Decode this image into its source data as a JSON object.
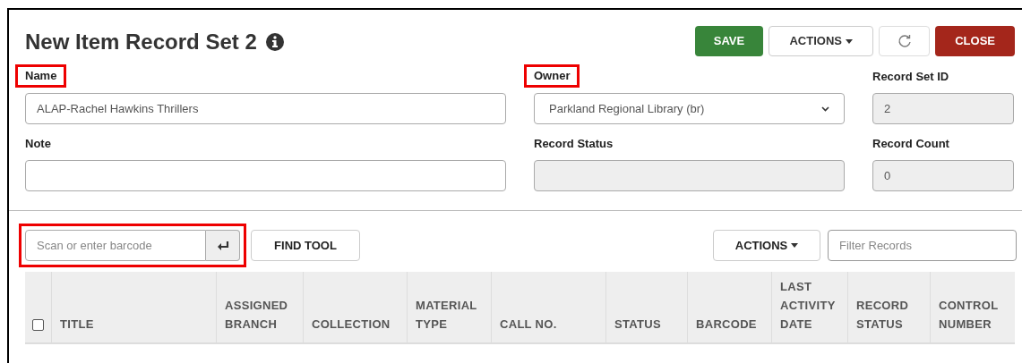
{
  "title": "New Item Record Set 2",
  "header_buttons": [
    {
      "kind": "save",
      "label": "SAVE"
    },
    {
      "kind": "dropdown",
      "label": "ACTIONS"
    },
    {
      "kind": "refresh"
    },
    {
      "kind": "close",
      "label": "CLOSE"
    }
  ],
  "fields": [
    {
      "label": "Name",
      "kind": "text",
      "value": "ALAP-Rachel Hawkins Thrillers",
      "highlighted": true,
      "readonly": false
    },
    {
      "label": "Owner",
      "kind": "select",
      "value": "Parkland Regional Library (br)",
      "highlighted": true,
      "readonly": false
    },
    {
      "label": "Record Set ID",
      "kind": "text",
      "value": "2",
      "highlighted": false,
      "readonly": true
    },
    {
      "label": "Note",
      "kind": "text",
      "highlighted": false,
      "readonly": false
    },
    {
      "label": "Record Status",
      "kind": "text",
      "highlighted": false,
      "readonly": true
    },
    {
      "label": "Record Count",
      "kind": "text",
      "value": "0",
      "highlighted": false,
      "readonly": true
    }
  ],
  "barcode": {
    "placeholder": "Scan or enter barcode",
    "highlighted": true
  },
  "find_tool": "FIND TOOL",
  "table_actions": "ACTIONS",
  "filter": {
    "placeholder": "Filter Records"
  },
  "table": {
    "select_all_checked": false,
    "columns": [
      [
        "TITLE"
      ],
      [
        "ASSIGNED",
        "BRANCH"
      ],
      [
        "COLLECTION"
      ],
      [
        "MATERIAL",
        "TYPE"
      ],
      [
        "CALL NO."
      ],
      [
        "STATUS"
      ],
      [
        "BARCODE"
      ],
      [
        "LAST",
        "ACTIVITY",
        "DATE"
      ],
      [
        "RECORD",
        "STATUS"
      ],
      [
        "CONTROL",
        "NUMBER"
      ]
    ]
  }
}
